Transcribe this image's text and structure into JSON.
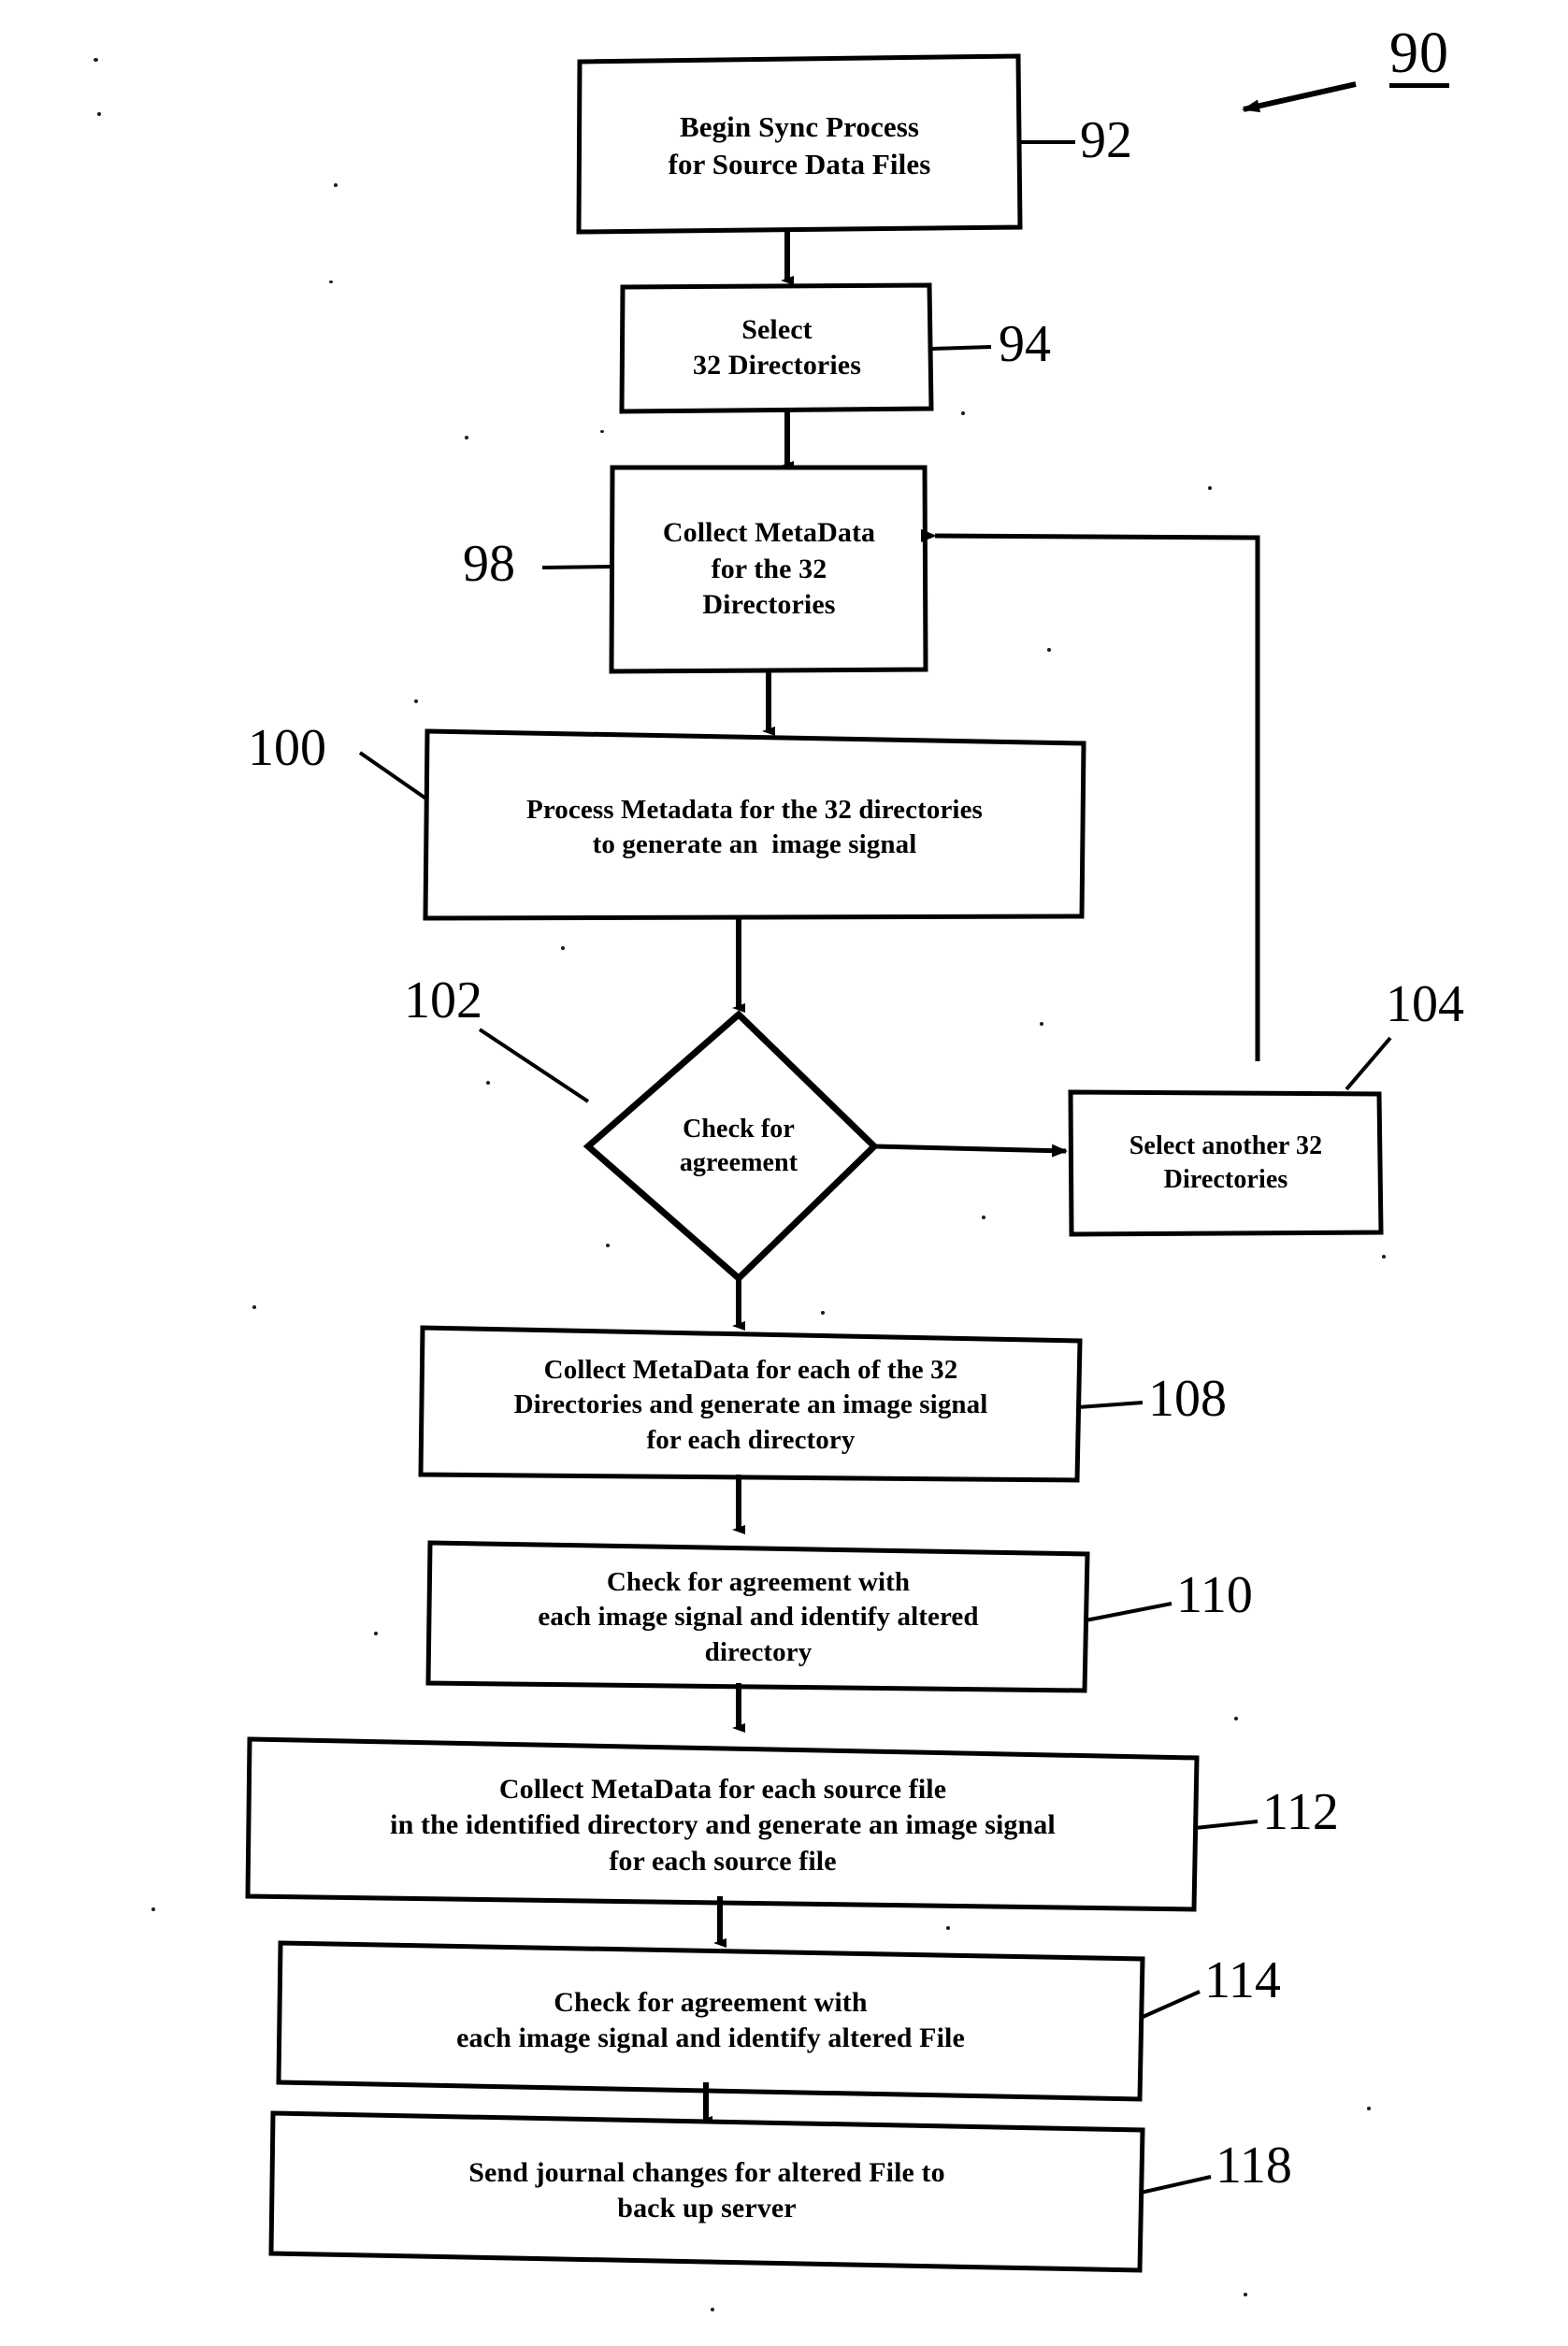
{
  "figure": {
    "reference_numeral": "90",
    "type": "patent-flowchart"
  },
  "nodes": [
    {
      "id": "92",
      "shape": "rectangle",
      "ref": "92",
      "lines": [
        "Begin Sync Process",
        "for Source Data Files"
      ]
    },
    {
      "id": "94",
      "shape": "rectangle",
      "ref": "94",
      "lines": [
        "Select",
        "32 Directories"
      ]
    },
    {
      "id": "98",
      "shape": "rectangle",
      "ref": "98",
      "lines": [
        "Collect MetaData",
        "for the 32",
        "Directories"
      ]
    },
    {
      "id": "100",
      "shape": "rectangle",
      "ref": "100",
      "lines": [
        "Process Metadata for the 32 directories",
        "to generate an  image signal"
      ]
    },
    {
      "id": "102",
      "shape": "diamond",
      "ref": "102",
      "lines": [
        "Check for",
        "agreement"
      ]
    },
    {
      "id": "104",
      "shape": "rectangle",
      "ref": "104",
      "lines": [
        "Select another 32",
        "Directories"
      ]
    },
    {
      "id": "108",
      "shape": "rectangle",
      "ref": "108",
      "lines": [
        "Collect MetaData for each of the 32",
        "Directories and generate an image signal",
        "for each directory"
      ]
    },
    {
      "id": "110",
      "shape": "rectangle",
      "ref": "110",
      "lines": [
        "Check for agreement with",
        "each image signal and identify altered",
        "directory"
      ]
    },
    {
      "id": "112",
      "shape": "rectangle",
      "ref": "112",
      "lines": [
        "Collect MetaData for each source file",
        "in the identified directory and generate an image signal",
        "for each source file"
      ]
    },
    {
      "id": "114",
      "shape": "rectangle",
      "ref": "114",
      "lines": [
        "Check for agreement with",
        "each image signal and identify altered File"
      ]
    },
    {
      "id": "118",
      "shape": "rectangle",
      "ref": "118",
      "lines": [
        "Send journal changes for altered File to",
        "back up server"
      ]
    }
  ],
  "colors": {
    "ink": "#000000",
    "paper": "#ffffff"
  }
}
